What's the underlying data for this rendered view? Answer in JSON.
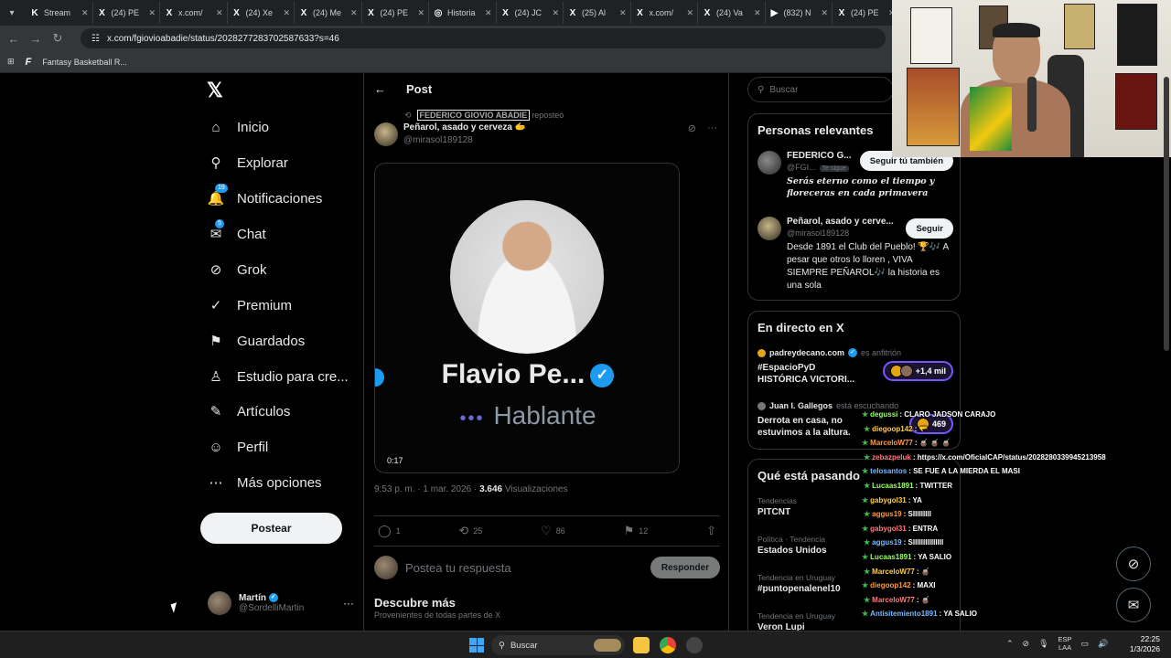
{
  "browser": {
    "tabs": [
      {
        "icon": "K",
        "label": "Stream"
      },
      {
        "icon": "X",
        "label": "(24) PE"
      },
      {
        "icon": "X",
        "label": "x.com/"
      },
      {
        "icon": "X",
        "label": "(24) Xe"
      },
      {
        "icon": "X",
        "label": "(24) Me"
      },
      {
        "icon": "X",
        "label": "(24) PE"
      },
      {
        "icon": "◎",
        "label": "Historia"
      },
      {
        "icon": "X",
        "label": "(24) JC"
      },
      {
        "icon": "X",
        "label": "(25) Al"
      },
      {
        "icon": "X",
        "label": "x.com/"
      },
      {
        "icon": "X",
        "label": "(24) Va"
      },
      {
        "icon": "▶",
        "label": "(832) N"
      },
      {
        "icon": "X",
        "label": "(24) PE"
      }
    ],
    "url": "x.com/fgiovioabadie/status/2028277283702587633?s=46",
    "bookmark": "Fantasy Basketball R..."
  },
  "nav": {
    "items": [
      {
        "label": "Inicio",
        "icon": "home-icon",
        "glyph": "⌂"
      },
      {
        "label": "Explorar",
        "icon": "search-icon",
        "glyph": "⚲"
      },
      {
        "label": "Notificaciones",
        "icon": "bell-icon",
        "glyph": "🔔",
        "badge": "19"
      },
      {
        "label": "Chat",
        "icon": "mail-icon",
        "glyph": "✉",
        "badge": "5"
      },
      {
        "label": "Grok",
        "icon": "grok-icon",
        "glyph": "⊘"
      },
      {
        "label": "Premium",
        "icon": "verified-icon",
        "glyph": "✓"
      },
      {
        "label": "Guardados",
        "icon": "bookmark-icon",
        "glyph": "⚑"
      },
      {
        "label": "Estudio para cre...",
        "icon": "studio-icon",
        "glyph": "♙"
      },
      {
        "label": "Artículos",
        "icon": "article-icon",
        "glyph": "✎"
      },
      {
        "label": "Perfil",
        "icon": "person-icon",
        "glyph": "☺"
      },
      {
        "label": "Más opciones",
        "icon": "more-icon",
        "glyph": "⋯"
      }
    ],
    "post_button": "Postear",
    "profile": {
      "name": "Martín",
      "handle": "@SordelliMartin",
      "more": "···"
    }
  },
  "post": {
    "header": "Post",
    "repost_by": "FEDERICO GIOVIO ABADIE",
    "repost_label": "reposteó",
    "author": "Peñarol, asado y cerveza",
    "author_emoji": "🫱",
    "handle": "@mirasol189128",
    "media": {
      "name": "Flavio Pe...",
      "sub": "Hablante",
      "duration": "0:17"
    },
    "time": "9:53 p. m. · 1 mar. 2026 · ",
    "views": "3.646",
    "views_label": " Visualizaciones",
    "stats": {
      "replies": "1",
      "reposts": "25",
      "likes": "86",
      "bookmarks": "12"
    },
    "reply_placeholder": "Postea tu respuesta",
    "reply_button": "Responder",
    "discover_title": "Descubre más",
    "discover_sub": "Provenientes de todas partes de X"
  },
  "sidebar": {
    "search_placeholder": "Buscar",
    "relevant_title": "Personas relevantes",
    "people": [
      {
        "name": "FEDERICO G...",
        "handle": "@FGI...",
        "follows_you": "Te sigue",
        "button": "Seguir tú también",
        "bio": "Serás eterno como el tiempo y floreceras en cada primavera"
      },
      {
        "name": "Peñarol, asado y cerve...",
        "handle": "@mirasol189128",
        "button": "Seguir",
        "bio": "Desde 1891 el Club del Pueblo! 🏆🎶 A pesar que otros lo lloren , VIVA SIEMPRE PEÑAROL🎶 la historia es una sola"
      }
    ],
    "live_title": "En directo en X",
    "live": [
      {
        "host": "padreydecano.com",
        "role": "es anfitrión",
        "title": "#EspacioPyD HISTÓRICA VICTORI...",
        "count": "+1,4 mil"
      },
      {
        "host": "Juan I. Gallegos",
        "role": "está escuchando",
        "title": "Derrota en casa, no estuvimos a la altura.",
        "count": "469"
      }
    ],
    "trends_title": "Qué está pasando",
    "trends": [
      {
        "category": "Tendencias",
        "name": "PITCNT"
      },
      {
        "category": "Política · Tendencia",
        "name": "Estados Unidos"
      },
      {
        "category": "Tendencia en Uruguay",
        "name": "#puntopenalenel10"
      },
      {
        "category": "Tendencia en Uruguay",
        "name": "Veron Lupi"
      }
    ]
  },
  "chat_overlay": [
    {
      "user": "degussi",
      "text": "CLARO JADSON CARAJO"
    },
    {
      "user": "diegoop142",
      "text": "🫳"
    },
    {
      "user": "MarceloW77",
      "text": "🧉 🧉 🧉"
    },
    {
      "user": "zebazpeluk",
      "text": "https://x.com/OficialCAP/status/2028280339945213958"
    },
    {
      "user": "telosantos",
      "text": "SE FUE A LA MIERDA EL MASI"
    },
    {
      "user": "Lucaas1891",
      "text": "TWITTER"
    },
    {
      "user": "gabygol31",
      "text": "YA"
    },
    {
      "user": "aggus19",
      "text": "SIIIIIIIII"
    },
    {
      "user": "gabygol31",
      "text": "ENTRA"
    },
    {
      "user": "aggus19",
      "text": "SIIIIIIIIIIIIIII"
    },
    {
      "user": "Lucaas1891",
      "text": "YA SALIO"
    },
    {
      "user": "MarceloW77",
      "text": "🧉"
    },
    {
      "user": "diegoop142",
      "text": "MAXI"
    },
    {
      "user": "MarceloW77",
      "text": "🧉"
    },
    {
      "user": "Antisitemiento1891",
      "text": "YA SALIO"
    }
  ],
  "taskbar": {
    "search": "Buscar",
    "lang": "ESP",
    "lang2": "LAA",
    "time": "22:25",
    "date": "1/3/2026"
  },
  "colors": {
    "accent": "#1d9bf0",
    "live": "#7856ff"
  }
}
